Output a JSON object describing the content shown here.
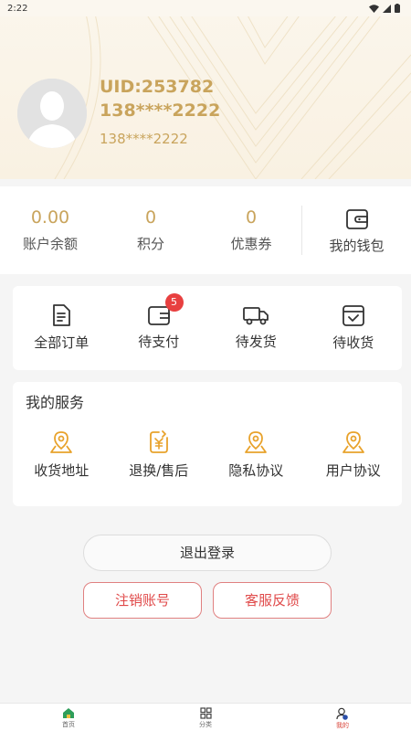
{
  "status_bar": {
    "time": "2:22"
  },
  "profile": {
    "uid": "UID:253782",
    "phone_masked": "138****2222",
    "phone_secondary": "138****2222"
  },
  "stats": [
    {
      "value": "0.00",
      "label": "账户余额"
    },
    {
      "value": "0",
      "label": "积分"
    },
    {
      "value": "0",
      "label": "优惠券"
    }
  ],
  "wallet": {
    "label": "我的钱包",
    "icon": "wallet-icon"
  },
  "orders": [
    {
      "label": "全部订单",
      "icon": "document-icon"
    },
    {
      "label": "待支付",
      "icon": "wallet-card-icon",
      "badge": "5"
    },
    {
      "label": "待发货",
      "icon": "truck-icon"
    },
    {
      "label": "待收货",
      "icon": "inbox-check-icon"
    }
  ],
  "services": {
    "title": "我的服务",
    "items": [
      {
        "label": "收货地址",
        "icon": "location-pin-icon"
      },
      {
        "label": "退换/售后",
        "icon": "yen-exchange-icon"
      },
      {
        "label": "隐私协议",
        "icon": "location-pin-icon"
      },
      {
        "label": "用户协议",
        "icon": "location-pin-icon"
      }
    ]
  },
  "buttons": {
    "logout": "退出登录",
    "cancel_account": "注销账号",
    "feedback": "客服反馈"
  },
  "tabbar": [
    {
      "label": "首页",
      "icon": "home-icon"
    },
    {
      "label": "分类",
      "icon": "grid-icon"
    },
    {
      "label": "我的",
      "icon": "user-icon",
      "active": true
    }
  ],
  "colors": {
    "gold": "#c9a45c",
    "accent_orange": "#e8a22b",
    "red": "#e04a4a"
  }
}
